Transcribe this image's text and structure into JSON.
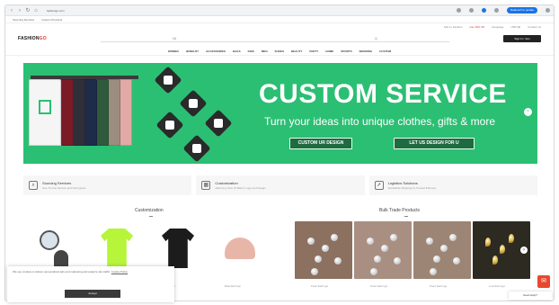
{
  "browser": {
    "url": "fashiongo.com",
    "bookmarks": [
      "Sourcing Services",
      "Custom Products"
    ],
    "profile_button": "Relaunch to update"
  },
  "topstrip": {
    "items": [
      "Sell on Fashion",
      "Get 40% Off",
      "Language",
      "USD ($)",
      "Contact Us"
    ]
  },
  "header": {
    "logo_main": "FASHION",
    "logo_accent": "GO",
    "search_left": "All",
    "search_right": "Q",
    "signin_label": "Sign In / Join"
  },
  "catnav": {
    "items": [
      "WOMEN",
      "JEWELRY",
      "ACCESSORIES",
      "BAGS",
      "KIDS",
      "MEN",
      "SHOES",
      "BEAUTY",
      "PARTY",
      "HOME",
      "SPORTS",
      "WEDDING",
      "CUSTOM"
    ]
  },
  "banner": {
    "title": "CUSTOM SERVICE",
    "subtitle": "Turn your ideas into unique clothes, gifts & more",
    "btn_primary": "CUSTOM UR DESIGN",
    "btn_secondary": "LET US DESIGN FOR U",
    "shirt_colors": [
      "#f5f5f5",
      "#b3202e",
      "#7a1b28",
      "#2f2f3a",
      "#1e2b4a",
      "#2f5a3c",
      "#9b8e80",
      "#e3a9a6"
    ],
    "shirt_print_color": "#2bbf73"
  },
  "features": [
    {
      "title": "Sourcing Services",
      "desc": "One To One Service and Fast Quote",
      "icon": "search-doc-icon"
    },
    {
      "title": "Customization",
      "desc": "Allow Any Size Of Batch, Logo and Design",
      "icon": "palette-icon"
    },
    {
      "title": "Logistics Solutions",
      "desc": "Worldwide Shipping by Trusted Partners",
      "icon": "truck-icon"
    }
  ],
  "sections": {
    "left_title": "Customization",
    "right_title": "Bulk Trade Products"
  },
  "products": [
    {
      "label": "Design your own",
      "color": "#d8e3ec",
      "icon": "design-icon"
    },
    {
      "label": "Polo Shirt",
      "color": "#b6f53a",
      "icon": "polo-shirt-icon"
    },
    {
      "label": "Polo Shirt",
      "color": "#1c1c1c",
      "icon": "polo-shirt-icon"
    },
    {
      "label": "Baseball Cap",
      "color": "#e8b6a8",
      "icon": "cap-icon"
    }
  ],
  "bulk_products": [
    {
      "label": "Pearl Earrings",
      "bg": "#8c7060"
    },
    {
      "label": "Pearl Earrings",
      "bg": "#a88f82"
    },
    {
      "label": "Pearl Earrings",
      "bg": "#9c8574"
    },
    {
      "label": "Leaf Earrings",
      "bg": "#2d2a22"
    }
  ],
  "cookie": {
    "text": "We use cookies to deliver personalized ads and marketing and analyze site traffic.",
    "link": "Cookie Policy",
    "button": "Accept"
  },
  "help_label": "Need Help?"
}
